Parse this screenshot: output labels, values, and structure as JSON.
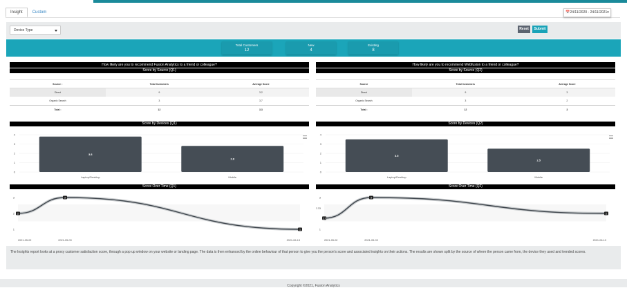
{
  "tabs": [
    {
      "label": "Insight",
      "active": true
    },
    {
      "label": "Custom",
      "active": false
    }
  ],
  "date_range": "📅24/11/2020 - 24/11/2021▾",
  "filters": {
    "device_type": "Device Type",
    "reset": "Reset",
    "submit": "Submit"
  },
  "kpis": [
    {
      "label": "Total Customers",
      "value": "12"
    },
    {
      "label": "New",
      "value": "4"
    },
    {
      "label": "Existing",
      "value": "8"
    }
  ],
  "panels": [
    {
      "question": "How likely are you to recommend Fusion Analytics to a friend or colleague?",
      "score_by_source_title": "Score by Source (Q1)",
      "table": {
        "headers": [
          "Source",
          "Total Customers",
          "Average Score"
        ],
        "rows": [
          [
            "Direct",
            "9",
            "3.2"
          ],
          [
            "Organic Search",
            "3",
            "3.7"
          ]
        ],
        "total": [
          "Total :",
          "12",
          "3.3"
        ]
      },
      "devices_title": "Score by Devices (Q1)",
      "over_time_title": "Score Over Time (Q1)"
    },
    {
      "question": "How likely are you to recommend Webfusion to a friend or colleague?",
      "score_by_source_title": "Score by Source (Q2)",
      "table": {
        "headers": [
          "Source",
          "Total Customers",
          "Average Score"
        ],
        "rows": [
          [
            "Direct",
            "9",
            "3"
          ],
          [
            "Organic Search",
            "3",
            "2"
          ]
        ],
        "total": [
          "Total :",
          "12",
          "3"
        ]
      },
      "devices_title": "Score by Devices (Q2)",
      "over_time_title": "Score Over Time (Q2)"
    }
  ],
  "chart_data": [
    {
      "type": "bar",
      "title": "Score by Devices (Q1)",
      "categories": [
        "Laptop/Desktop",
        "Mobile"
      ],
      "values": [
        3.8,
        2.8
      ],
      "ylim": [
        0,
        4
      ],
      "yticks": [
        0,
        1,
        2,
        3,
        4
      ],
      "bar_color": "#454d55"
    },
    {
      "type": "bar",
      "title": "Score by Devices (Q2)",
      "categories": [
        "Laptop/Desktop",
        "Mobile"
      ],
      "values": [
        3.5,
        2.5
      ],
      "ylim": [
        0,
        4
      ],
      "yticks": [
        0,
        1,
        2,
        3,
        4
      ],
      "bar_color": "#454d55"
    },
    {
      "type": "line",
      "title": "Score Over Time (Q1)",
      "x": [
        "2021-05-02",
        "2021-05-09",
        "2021-06-13"
      ],
      "values": [
        2,
        3,
        1
      ],
      "labels": [
        "2",
        "3",
        "1"
      ],
      "yticks": [
        "1",
        "2",
        "3"
      ],
      "ylim": [
        1,
        3
      ]
    },
    {
      "type": "line",
      "title": "Score Over Time (Q2)",
      "x": [
        "2021-05-02",
        "2021-05-09",
        "2021-06-13"
      ],
      "values": [
        1.7,
        3,
        2
      ],
      "labels": [
        "1.7",
        "3",
        "2"
      ],
      "yticks": [
        "1",
        "2.33",
        "3"
      ],
      "ylim": [
        1,
        3
      ]
    }
  ],
  "description": "The Insights report looks at a proxy customer satisfaction score, through a pop up window on your website or landing page. The data is then enhanced by the online behaviour of that person to give you the person's score and associated insights on their actions. The results are shown split by the source of where the person came from, the device they used and trended scores.",
  "copyright": "Copyright ©2021, Fusion Analytics"
}
